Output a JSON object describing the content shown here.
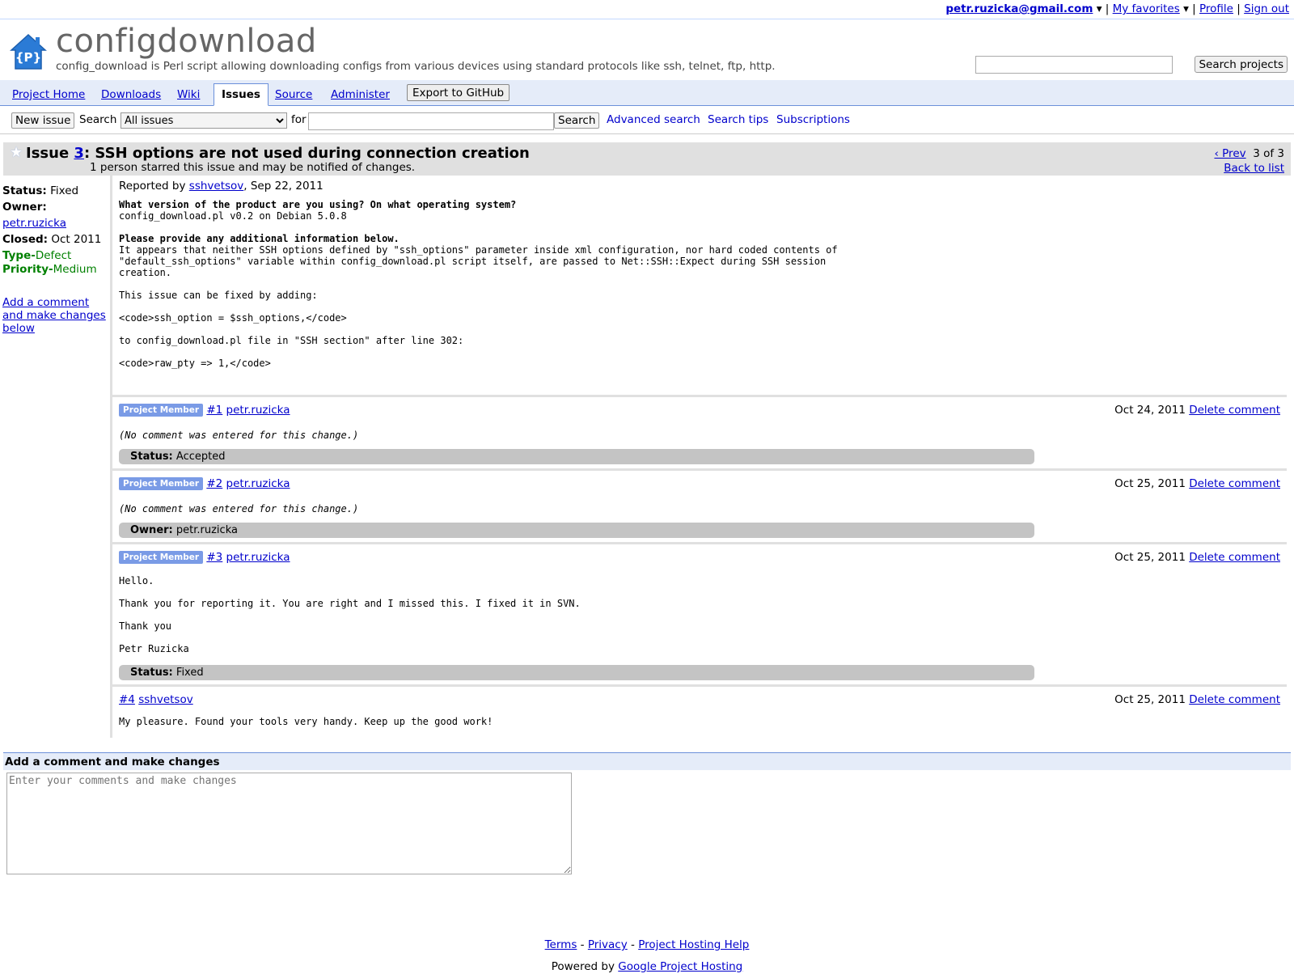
{
  "userbar": {
    "email": "petr.ruzicka@gmail.com",
    "favorites": "My favorites",
    "profile": "Profile",
    "signout": "Sign out",
    "arrow": "▾",
    "sep": "|"
  },
  "header": {
    "project_name": "configdownload",
    "summary": "config_download is Perl script allowing downloading configs from various devices using standard protocols like ssh, telnet, ftp, http.",
    "search_button": "Search projects",
    "logo_text": "{P}"
  },
  "tabs": {
    "items": [
      "Project Home",
      "Downloads",
      "Wiki",
      "Issues",
      "Source",
      "Administer"
    ],
    "active": "Issues",
    "export_button": "Export to GitHub"
  },
  "toolbar": {
    "new_issue": "New issue",
    "search_label": "Search",
    "search_scope": "All issues",
    "for_label": "for",
    "search_button": "Search",
    "advanced_search": "Advanced search",
    "search_tips": "Search tips",
    "subscriptions": "Subscriptions"
  },
  "issue": {
    "prefix": "Issue ",
    "number": "3",
    "title": ": SSH options are not used during connection creation",
    "starred_text": "1 person starred this issue and may be notified of changes.",
    "prev": "‹ Prev",
    "position": "3 of 3",
    "back": "Back to list",
    "meta": {
      "status_label": "Status:",
      "status": "Fixed",
      "owner_label": "Owner:",
      "owner": "petr.ruzicka",
      "closed_label": "Closed:",
      "closed": "Oct 2011",
      "type_label": "Type-",
      "type": "Defect",
      "priority_label": "Priority-",
      "priority": "Medium",
      "add_comment_link": "Add a comment and make changes below"
    },
    "reported_prefix": "Reported by ",
    "reporter": "sshvetsov",
    "reported_date": ", Sep 22, 2011",
    "q1": "What version of the product are you using? On what operating system?",
    "a1": "config_download.pl v0.2 on Debian 5.0.8",
    "q2": "Please provide any additional information below.",
    "a2": "It appears that neither SSH options defined by \"ssh_options\" parameter inside xml configuration, nor hard coded contents of\n\"default_ssh_options\" variable within config_download.pl script itself, are passed to Net::SSH::Expect during SSH session\ncreation.\n\nThis issue can be fixed by adding:\n\n<code>ssh_option = $ssh_options,</code>\n\nto config_download.pl file in \"SSH section\" after line 302:\n\n<code>raw_pty => 1,</code>"
  },
  "comments": [
    {
      "badge": "Project Member",
      "num": "#1",
      "author": "petr.ruzicka",
      "date": "Oct 24, 2011",
      "delete": "Delete comment",
      "body": "(No comment was entered for this change.)",
      "update_label": "Status:",
      "update_value": "Accepted"
    },
    {
      "badge": "Project Member",
      "num": "#2",
      "author": "petr.ruzicka",
      "date": "Oct 25, 2011",
      "delete": "Delete comment",
      "body": "(No comment was entered for this change.)",
      "update_label": "Owner:",
      "update_value": "petr.ruzicka"
    },
    {
      "badge": "Project Member",
      "num": "#3",
      "author": "petr.ruzicka",
      "date": "Oct 25, 2011",
      "delete": "Delete comment",
      "body": "Hello.\n\nThank you for reporting it. You are right and I missed this. I fixed it in SVN.\n\nThank you\n\nPetr Ruzicka",
      "update_label": "Status:",
      "update_value": "Fixed"
    },
    {
      "num": "#4",
      "author": "sshvetsov",
      "date": "Oct 25, 2011",
      "delete": "Delete comment",
      "body": "My pleasure. Found your tools very handy. Keep up the good work!"
    }
  ],
  "add_comment": {
    "heading": "Add a comment and make changes",
    "placeholder": "Enter your comments and make changes"
  },
  "footer": {
    "terms": "Terms",
    "privacy": "Privacy",
    "help": "Project Hosting Help",
    "dash": " - ",
    "powered": "Powered by ",
    "powered_link": "Google Project Hosting"
  },
  "colors": {
    "link": "#0000cc",
    "tabbar_bg": "#e5ecf9",
    "tab_border": "#6b90da",
    "badge_bg": "#7a9be6",
    "meta_green": "#008000",
    "logo_blue": "#2b7bd6"
  },
  "icons": {
    "logo": "house-icon",
    "star": "star-icon",
    "dropdown": "chevron-down-icon"
  }
}
